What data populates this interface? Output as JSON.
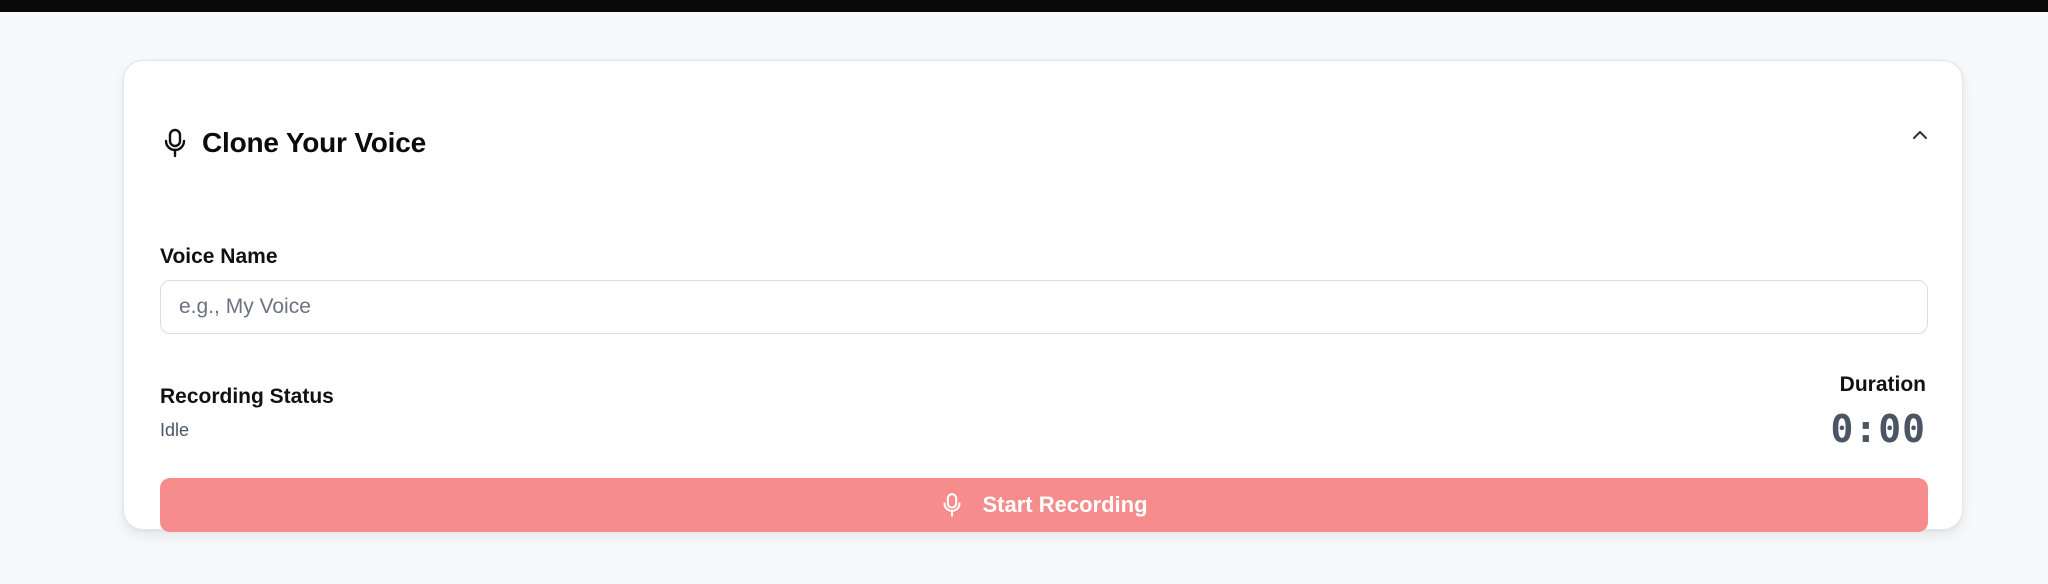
{
  "card": {
    "title": "Clone Your Voice",
    "title_icon": "microphone-icon",
    "collapse_icon": "chevron-up-icon"
  },
  "voice_name": {
    "label": "Voice Name",
    "value": "",
    "placeholder": "e.g., My Voice"
  },
  "recording_status": {
    "label": "Recording Status",
    "value": "Idle"
  },
  "duration": {
    "label": "Duration",
    "value": "0:00"
  },
  "record_button": {
    "label": "Start Recording",
    "icon": "microphone-icon"
  },
  "colors": {
    "page_background": "#f8f9fb",
    "record_button": "#f78c8c",
    "top_bar": "#0a0a0a"
  }
}
